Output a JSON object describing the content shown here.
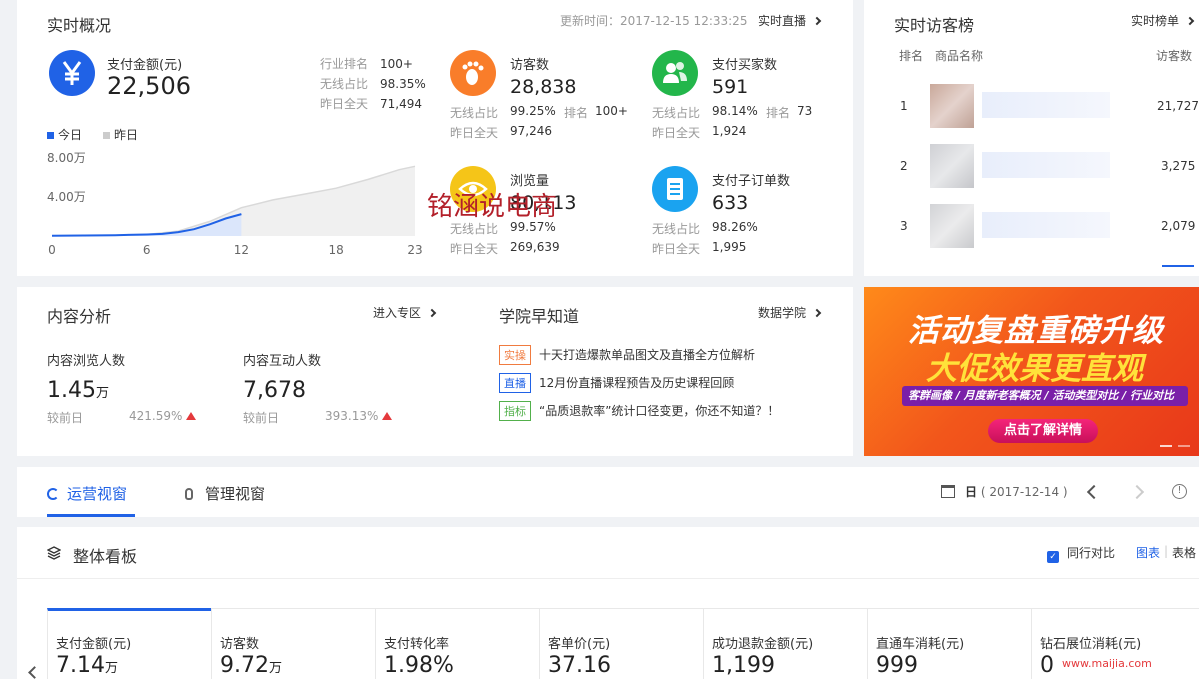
{
  "realtime": {
    "title": "实时概况",
    "update_time": "更新时间：2017-12-15 12:33:25",
    "live_link": "实时直播",
    "payment": {
      "label": "支付金额(元)",
      "value": "22,506",
      "stats": [
        {
          "k": "行业排名",
          "v": "100+"
        },
        {
          "k": "无线占比",
          "v": "98.35%"
        },
        {
          "k": "昨日全天",
          "v": "71,494"
        }
      ]
    },
    "legend_today": "今日",
    "legend_yesterday": "昨日",
    "visitors": {
      "label": "访客数",
      "value": "28,838",
      "r1k": "无线占比",
      "r1v": "99.25%",
      "r1k2": "排名",
      "r1v2": "100+",
      "r2k": "昨日全天",
      "r2v": "97,246"
    },
    "buyers": {
      "label": "支付买家数",
      "value": "591",
      "r1k": "无线占比",
      "r1v": "98.14%",
      "r1k2": "排名",
      "r1v2": "73",
      "r2k": "昨日全天",
      "r2v": "1,924"
    },
    "pageviews": {
      "label": "浏览量",
      "value": "80,113",
      "r1k": "无线占比",
      "r1v": "99.57%",
      "r2k": "昨日全天",
      "r2v": "269,639"
    },
    "suborders": {
      "label": "支付子订单数",
      "value": "633",
      "r1k": "无线占比",
      "r1v": "98.26%",
      "r2k": "昨日全天",
      "r2v": "1,995"
    },
    "watermark": "铭涵说电商"
  },
  "chart_data": {
    "type": "area",
    "x_ticks": [
      "0",
      "6",
      "12",
      "18",
      "23"
    ],
    "y_ticks": [
      "8.00万",
      "4.00万"
    ],
    "series": [
      {
        "name": "今日",
        "color": "#2062e6",
        "x": [
          0,
          2,
          4,
          6,
          7,
          8,
          9,
          10,
          11,
          12
        ],
        "y": [
          0.02,
          0.05,
          0.08,
          0.15,
          0.22,
          0.4,
          0.7,
          1.2,
          1.8,
          2.25
        ]
      },
      {
        "name": "昨日",
        "color": "#d9d9d9",
        "x": [
          0,
          2,
          4,
          6,
          8,
          10,
          12,
          14,
          16,
          18,
          20,
          22,
          23
        ],
        "y": [
          0.02,
          0.05,
          0.08,
          0.15,
          0.5,
          1.5,
          2.9,
          3.7,
          4.3,
          4.9,
          5.8,
          6.8,
          7.15
        ]
      }
    ],
    "ylim": [
      0,
      8
    ],
    "xlim": [
      0,
      23
    ]
  },
  "visitor_rank": {
    "title": "实时访客榜",
    "link": "实时榜单",
    "col_rank": "排名",
    "col_name": "商品名称",
    "col_visitors": "访客数",
    "rows": [
      {
        "rank": "1",
        "visitors": "21,727"
      },
      {
        "rank": "2",
        "visitors": "3,275"
      },
      {
        "rank": "3",
        "visitors": "2,079"
      }
    ]
  },
  "content": {
    "title": "内容分析",
    "link": "进入专区",
    "browse": {
      "label": "内容浏览人数",
      "value": "1.45",
      "unit": "万",
      "cmp": "较前日",
      "pct": "421.59%"
    },
    "interact": {
      "label": "内容互动人数",
      "value": "7,678",
      "cmp": "较前日",
      "pct": "393.13%"
    }
  },
  "academy": {
    "title": "学院早知道",
    "link": "数据学院",
    "items": [
      {
        "tag": "实操",
        "tag_color": "#f07b3f",
        "text": "十天打造爆款单品图文及直播全方位解析"
      },
      {
        "tag": "直播",
        "tag_color": "#2062e6",
        "text": "12月份直播课程预告及历史课程回顾"
      },
      {
        "tag": "指标",
        "tag_color": "#52b04b",
        "text": "“品质退款率”统计口径变更，你还不知道？！"
      }
    ]
  },
  "banner": {
    "line1": "活动复盘重磅升级",
    "line2": "大促效果更直观",
    "line3": "客群画像 / 月度新老客概况 / 活动类型对比 / 行业对比",
    "button": "点击了解详情"
  },
  "tabs": {
    "ops": "运营视窗",
    "mgmt": "管理视窗",
    "date_prefix": "日",
    "date": "( 2017-12-14 )"
  },
  "board": {
    "title": "整体看板",
    "compare": "同行对比",
    "view_chart": "图表",
    "view_table": "表格",
    "metrics": [
      {
        "label": "支付金额(元)",
        "value": "7.14",
        "unit": "万"
      },
      {
        "label": "访客数",
        "value": "9.72",
        "unit": "万"
      },
      {
        "label": "支付转化率",
        "value": "1.98%",
        "unit": ""
      },
      {
        "label": "客单价(元)",
        "value": "37.16",
        "unit": ""
      },
      {
        "label": "成功退款金额(元)",
        "value": "1,199",
        "unit": ""
      },
      {
        "label": "直通车消耗(元)",
        "value": "999",
        "unit": ""
      },
      {
        "label": "钻石展位消耗(元)",
        "value": "0",
        "unit": ""
      }
    ]
  },
  "footer_watermark": "www.maijia.com"
}
